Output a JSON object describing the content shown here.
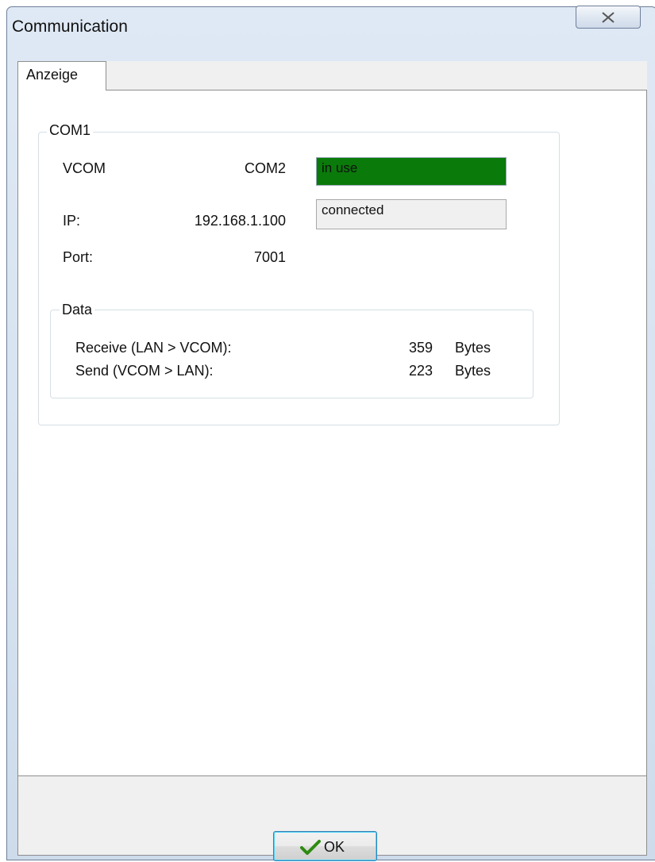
{
  "window": {
    "title": "Communication"
  },
  "tabs": [
    {
      "label": "Anzeige"
    }
  ],
  "com_group": {
    "label": "COM1",
    "vcom_label": "VCOM",
    "vcom_value": "COM2",
    "ip_label": "IP:",
    "ip_value": "192.168.1.100",
    "port_label": "Port:",
    "port_value": "7001",
    "status_use": "in use",
    "status_connection": "connected"
  },
  "data_group": {
    "label": "Data",
    "receive_label": "Receive (LAN > VCOM):",
    "receive_value": "359",
    "receive_unit": "Bytes",
    "send_label": "Send (VCOM > LAN):",
    "send_value": "223",
    "send_unit": "Bytes"
  },
  "footer": {
    "ok_label": "OK"
  },
  "colors": {
    "in_use_bg": "#0a7a0a",
    "ok_check": "#2e8b12"
  }
}
